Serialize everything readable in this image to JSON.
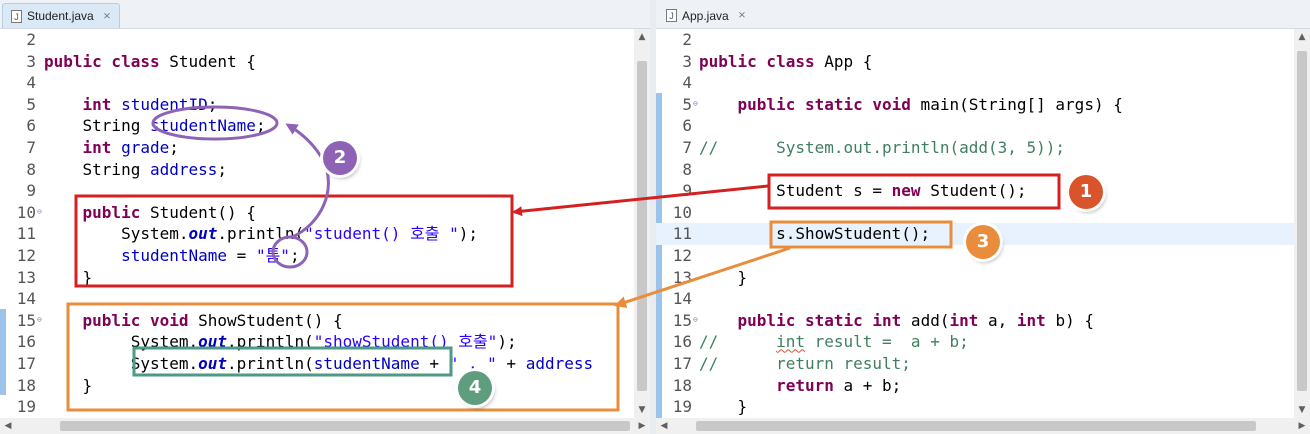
{
  "left_editor": {
    "tab_title": "Student.java",
    "tab_close": "⨯",
    "file_icon": "J",
    "lines": [
      {
        "n": "2",
        "tokens": []
      },
      {
        "n": "3",
        "tokens": [
          {
            "t": "public class",
            "c": "kw"
          },
          {
            "t": " Student {"
          }
        ]
      },
      {
        "n": "4",
        "tokens": []
      },
      {
        "n": "5",
        "tokens": [
          {
            "t": "    "
          },
          {
            "t": "int",
            "c": "kw"
          },
          {
            "t": " "
          },
          {
            "t": "studentID",
            "c": "fld"
          },
          {
            "t": ";"
          }
        ]
      },
      {
        "n": "6",
        "tokens": [
          {
            "t": "    String "
          },
          {
            "t": "studentName",
            "c": "fld"
          },
          {
            "t": ";"
          }
        ]
      },
      {
        "n": "7",
        "tokens": [
          {
            "t": "    "
          },
          {
            "t": "int",
            "c": "kw"
          },
          {
            "t": " "
          },
          {
            "t": "grade",
            "c": "fld"
          },
          {
            "t": ";"
          }
        ]
      },
      {
        "n": "8",
        "tokens": [
          {
            "t": "    String "
          },
          {
            "t": "address",
            "c": "fld"
          },
          {
            "t": ";"
          }
        ]
      },
      {
        "n": "9",
        "tokens": []
      },
      {
        "n": "10",
        "fold": true,
        "tokens": [
          {
            "t": "    "
          },
          {
            "t": "public",
            "c": "kw"
          },
          {
            "t": " Student() {"
          }
        ]
      },
      {
        "n": "11",
        "tokens": [
          {
            "t": "        System."
          },
          {
            "t": "out",
            "c": "sfld"
          },
          {
            "t": ".println("
          },
          {
            "t": "\"student() 호출 \"",
            "c": "str"
          },
          {
            "t": ");"
          }
        ]
      },
      {
        "n": "12",
        "tokens": [
          {
            "t": "        "
          },
          {
            "t": "studentName",
            "c": "fld"
          },
          {
            "t": " = "
          },
          {
            "t": "\"톰\"",
            "c": "str"
          },
          {
            "t": ";"
          }
        ]
      },
      {
        "n": "13",
        "tokens": [
          {
            "t": "    }"
          }
        ]
      },
      {
        "n": "14",
        "tokens": []
      },
      {
        "n": "15",
        "fold": true,
        "tokens": [
          {
            "t": "    "
          },
          {
            "t": "public void",
            "c": "kw"
          },
          {
            "t": " ShowStudent() {"
          }
        ]
      },
      {
        "n": "16",
        "tokens": [
          {
            "t": "         System."
          },
          {
            "t": "out",
            "c": "sfld"
          },
          {
            "t": ".println("
          },
          {
            "t": "\"showStudent() 호출\"",
            "c": "str"
          },
          {
            "t": ");"
          }
        ]
      },
      {
        "n": "17",
        "tokens": [
          {
            "t": "         System."
          },
          {
            "t": "out",
            "c": "sfld"
          },
          {
            "t": ".println("
          },
          {
            "t": "studentName",
            "c": "fld"
          },
          {
            "t": " + "
          },
          {
            "t": "\" , \"",
            "c": "str"
          },
          {
            "t": " + "
          },
          {
            "t": "address",
            "c": "fld"
          }
        ]
      },
      {
        "n": "18",
        "tokens": [
          {
            "t": "    }"
          }
        ]
      },
      {
        "n": "19",
        "tokens": []
      }
    ]
  },
  "right_editor": {
    "tab_title": "App.java",
    "tab_close": "⨯",
    "file_icon": "J",
    "current_line": "11",
    "lines": [
      {
        "n": "2",
        "tokens": []
      },
      {
        "n": "3",
        "tokens": [
          {
            "t": "public class",
            "c": "kw"
          },
          {
            "t": " App {"
          }
        ]
      },
      {
        "n": "4",
        "tokens": []
      },
      {
        "n": "5",
        "fold": true,
        "tokens": [
          {
            "t": "    "
          },
          {
            "t": "public static void",
            "c": "kw"
          },
          {
            "t": " main(String[] args) {"
          }
        ]
      },
      {
        "n": "6",
        "tokens": []
      },
      {
        "n": "7",
        "tokens": [
          {
            "t": "//      System.out.println(add(3, 5));",
            "c": "cmt"
          }
        ]
      },
      {
        "n": "8",
        "tokens": []
      },
      {
        "n": "9",
        "tokens": [
          {
            "t": "        Student s = "
          },
          {
            "t": "new",
            "c": "kw"
          },
          {
            "t": " Student();"
          }
        ]
      },
      {
        "n": "10",
        "tokens": []
      },
      {
        "n": "11",
        "tokens": [
          {
            "t": "        s.ShowStudent();"
          }
        ]
      },
      {
        "n": "12",
        "tokens": []
      },
      {
        "n": "13",
        "tokens": [
          {
            "t": "    }"
          }
        ]
      },
      {
        "n": "14",
        "tokens": []
      },
      {
        "n": "15",
        "fold": true,
        "tokens": [
          {
            "t": "    "
          },
          {
            "t": "public static int",
            "c": "kw"
          },
          {
            "t": " add("
          },
          {
            "t": "int",
            "c": "kw"
          },
          {
            "t": " a, "
          },
          {
            "t": "int",
            "c": "kw"
          },
          {
            "t": " b) {"
          }
        ]
      },
      {
        "n": "16",
        "tokens": [
          {
            "t": "//      ",
            "c": "cmt"
          },
          {
            "t": "int",
            "c": "cmt squig"
          },
          {
            "t": " result =  a + b;",
            "c": "cmt"
          }
        ]
      },
      {
        "n": "17",
        "tokens": [
          {
            "t": "//      return result;",
            "c": "cmt"
          }
        ]
      },
      {
        "n": "18",
        "tokens": [
          {
            "t": "        "
          },
          {
            "t": "return",
            "c": "kw"
          },
          {
            "t": " a + b;"
          }
        ]
      },
      {
        "n": "19",
        "tokens": [
          {
            "t": "    }"
          }
        ]
      }
    ]
  },
  "scroll_arrows": {
    "up": "▲",
    "down": "▼",
    "left": "◀",
    "right": "▶"
  },
  "badges": [
    {
      "label": "1",
      "color": "#d9542b"
    },
    {
      "label": "2",
      "color": "#8e63b5"
    },
    {
      "label": "3",
      "color": "#e98d3c"
    },
    {
      "label": "4",
      "color": "#5f9d7f"
    }
  ],
  "colors": {
    "box1": "#d42020",
    "box2": "#8e63b5",
    "box3": "#e98d3c",
    "box4": "#4e9a86"
  }
}
